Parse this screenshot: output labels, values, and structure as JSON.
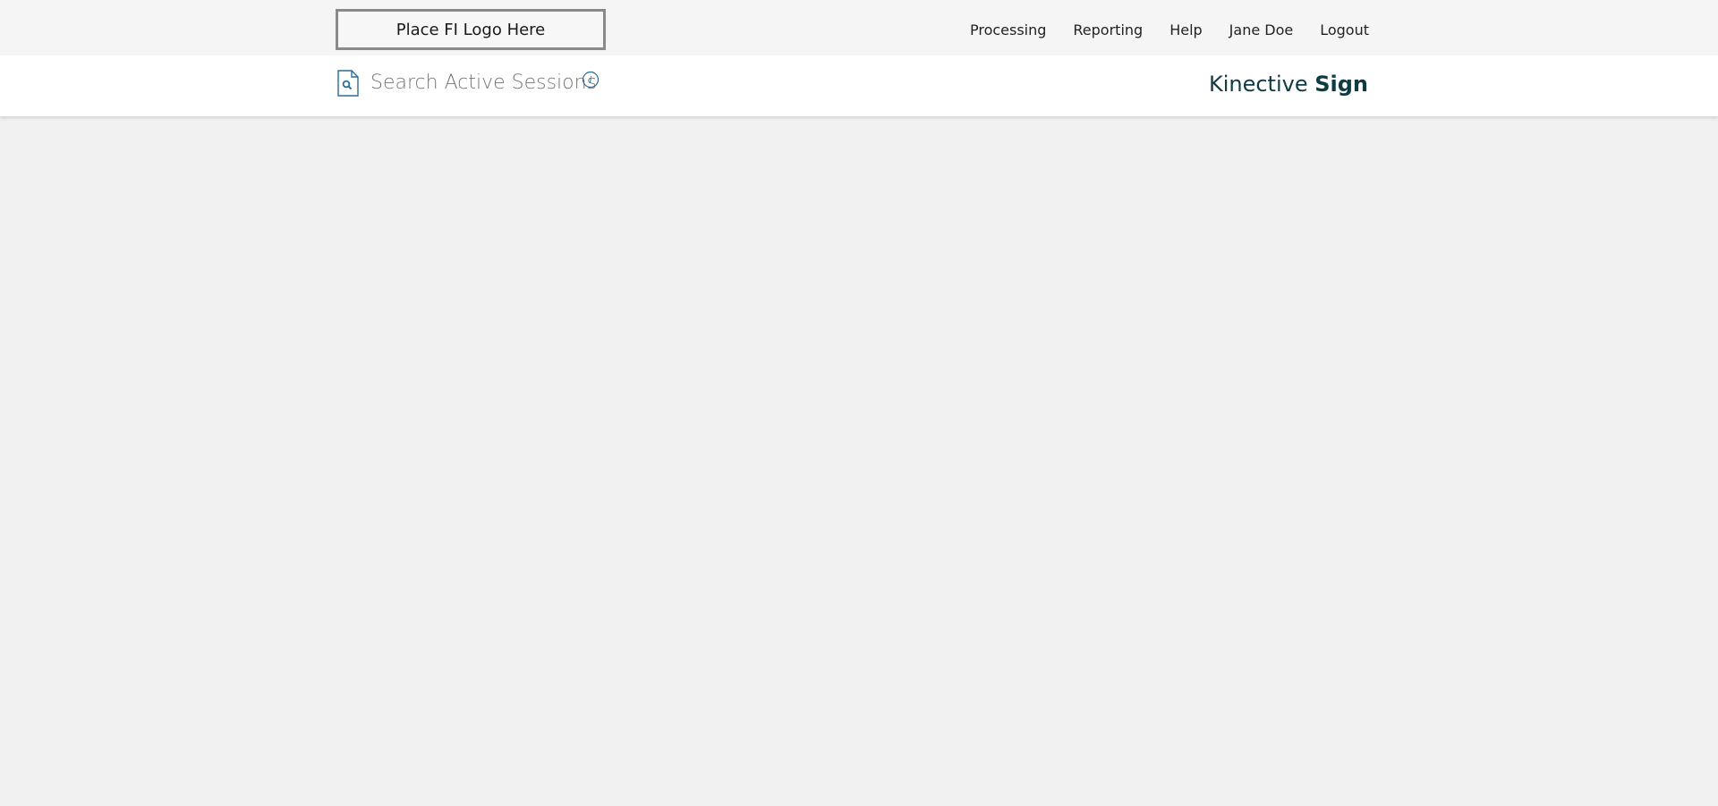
{
  "header": {
    "logo_placeholder": "Place FI Logo Here",
    "nav": [
      {
        "label": "Processing"
      },
      {
        "label": "Reporting"
      },
      {
        "label": "Help"
      },
      {
        "label": "Jane Doe"
      },
      {
        "label": "Logout"
      }
    ]
  },
  "subheader": {
    "title": "Search Active Sessions",
    "brand_part1": "Kinective",
    "brand_part2": "Sign",
    "icons": [
      "document-search-icon",
      "info-icon"
    ]
  },
  "colors": {
    "brand": "#0f3b44",
    "accent": "#2b6b93",
    "background": "#f0f0f0"
  }
}
